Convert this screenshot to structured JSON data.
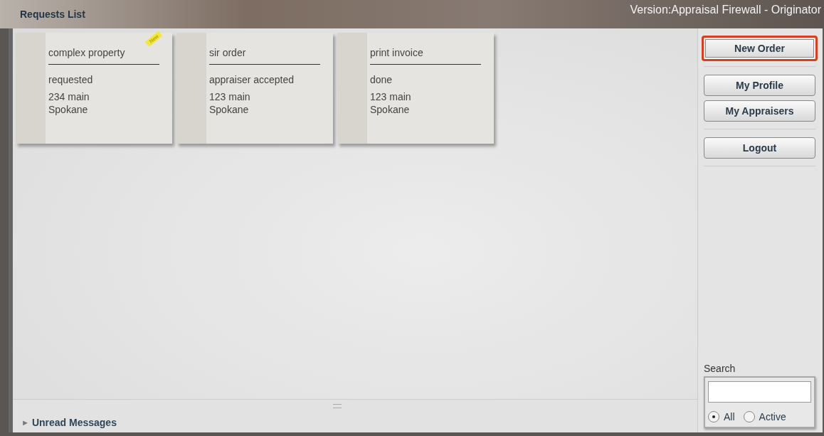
{
  "header": {
    "title": "Requests List",
    "version": "Version:Appraisal Firewall - Originator"
  },
  "requests": [
    {
      "title": "complex property",
      "status": "requested",
      "address": "234 main",
      "city": "Spokane",
      "badge": "New"
    },
    {
      "title": "sir order",
      "status": "appraiser accepted",
      "address": "123 main",
      "city": "Spokane"
    },
    {
      "title": "print invoice",
      "status": "done",
      "address": "123 main",
      "city": "Spokane"
    }
  ],
  "sidebar": {
    "button_groups": [
      {
        "buttons": [
          {
            "label": "New Order",
            "highlighted": true
          }
        ]
      },
      {
        "buttons": [
          {
            "label": "My Profile",
            "highlighted": false
          },
          {
            "label": "My Appraisers",
            "highlighted": false
          }
        ]
      },
      {
        "buttons": [
          {
            "label": "Logout",
            "highlighted": false
          }
        ]
      }
    ],
    "search": {
      "label": "Search",
      "filters": [
        {
          "label": "All",
          "selected": true
        },
        {
          "label": "Active",
          "selected": false
        }
      ]
    }
  },
  "footer": {
    "toggle": "►",
    "label": "Unread Messages"
  }
}
